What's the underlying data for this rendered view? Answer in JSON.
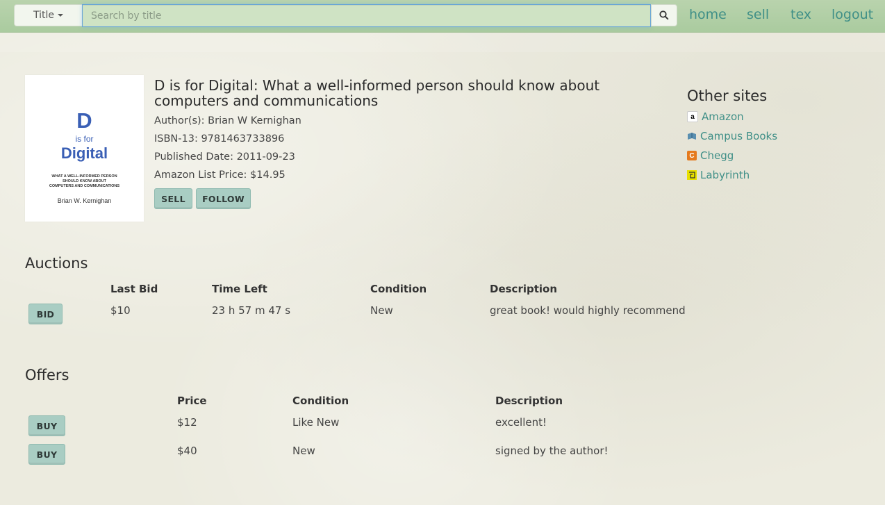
{
  "navbar": {
    "search_type": "Title",
    "search_placeholder": "Search by title",
    "links": [
      "home",
      "sell",
      "tex",
      "logout"
    ]
  },
  "book": {
    "cover": {
      "big_letter": "D",
      "is_for": "is for",
      "word": "Digital",
      "subtitle_lines": [
        "WHAT A WELL-INFORMED PERSON",
        "SHOULD KNOW ABOUT",
        "COMPUTERS AND COMMUNICATIONS"
      ],
      "author": "Brian W. Kernighan"
    },
    "title": "D is for Digital: What a well-informed person should know about computers and communications",
    "authors": "Author(s): Brian W Kernighan",
    "isbn": "ISBN-13: 9781463733896",
    "published": "Published Date: 2011-09-23",
    "price": "Amazon List Price: $14.95",
    "sell_label": "SELL",
    "follow_label": "FOLLOW"
  },
  "other_sites": {
    "heading": "Other sites",
    "sites": [
      {
        "name": "Amazon",
        "icon": "amazon-icon",
        "glyph": "a",
        "color": "#ffffff"
      },
      {
        "name": "Campus Books",
        "icon": "campus-books-icon",
        "glyph": "",
        "color": "#5a8fb0"
      },
      {
        "name": "Chegg",
        "icon": "chegg-icon",
        "glyph": "C",
        "color": "#e57a1e"
      },
      {
        "name": "Labyrinth",
        "icon": "labyrinth-icon",
        "glyph": "",
        "color": "#e8e000"
      }
    ]
  },
  "auctions": {
    "heading": "Auctions",
    "columns": [
      "Last Bid",
      "Time Left",
      "Condition",
      "Description"
    ],
    "rows": [
      {
        "action": "BID",
        "last_bid": "$10",
        "time_left": "23 h 57 m 47 s",
        "condition": "New",
        "description": "great book! would highly recommend"
      }
    ]
  },
  "offers": {
    "heading": "Offers",
    "columns": [
      "Price",
      "Condition",
      "Description"
    ],
    "rows": [
      {
        "action": "BUY",
        "price": "$12",
        "condition": "Like New",
        "description": "excellent!"
      },
      {
        "action": "BUY",
        "price": "$40",
        "condition": "New",
        "description": "signed by the author!"
      }
    ]
  },
  "colors": {
    "navbar": "#aecda2",
    "link": "#3f8f87",
    "button": "#a9cdc3",
    "background": "#ecebdf"
  }
}
